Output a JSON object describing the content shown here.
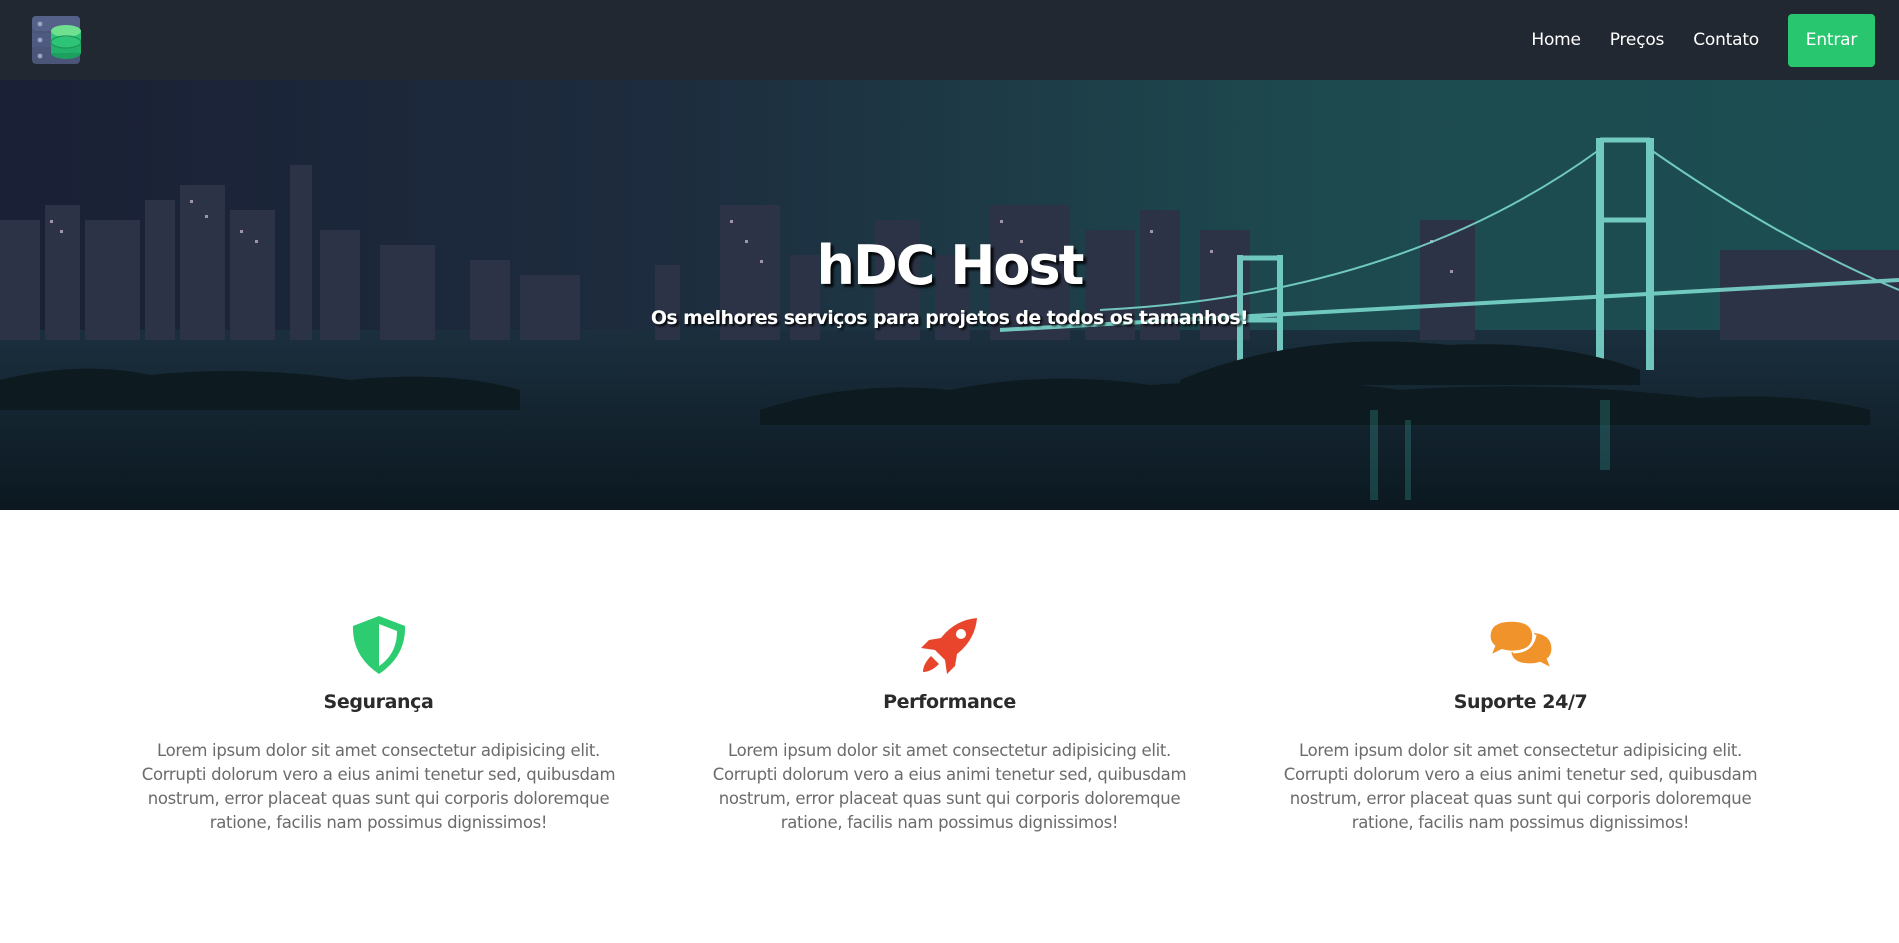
{
  "colors": {
    "navbar_bg": "#222831",
    "accent_green": "#28c76f",
    "icon_green": "#2ecc71",
    "icon_red": "#e8452c",
    "icon_orange": "#f0932b",
    "text_dark": "#2b2b2b",
    "text_muted": "#6b6b6b"
  },
  "navbar": {
    "logo_icon": "server-database-icon",
    "links": [
      {
        "label": "Home"
      },
      {
        "label": "Preços"
      },
      {
        "label": "Contato"
      }
    ],
    "login_label": "Entrar"
  },
  "hero": {
    "title": "hDC Host",
    "subtitle": "Os melhores serviços para projetos de todos os tamanhos!",
    "background": "night-city-bridge-photo"
  },
  "features": [
    {
      "icon": "shield-icon",
      "title": "Segurança",
      "text": "Lorem ipsum dolor sit amet consectetur adipisicing elit. Corrupti dolorum vero a eius animi tenetur sed, quibusdam nostrum, error placeat quas sunt qui corporis doloremque ratione, facilis nam possimus dignissimos!"
    },
    {
      "icon": "rocket-icon",
      "title": "Performance",
      "text": "Lorem ipsum dolor sit amet consectetur adipisicing elit. Corrupti dolorum vero a eius animi tenetur sed, quibusdam nostrum, error placeat quas sunt qui corporis doloremque ratione, facilis nam possimus dignissimos!"
    },
    {
      "icon": "chat-bubbles-icon",
      "title": "Suporte 24/7",
      "text": "Lorem ipsum dolor sit amet consectetur adipisicing elit. Corrupti dolorum vero a eius animi tenetur sed, quibusdam nostrum, error placeat quas sunt qui corporis doloremque ratione, facilis nam possimus dignissimos!"
    }
  ]
}
